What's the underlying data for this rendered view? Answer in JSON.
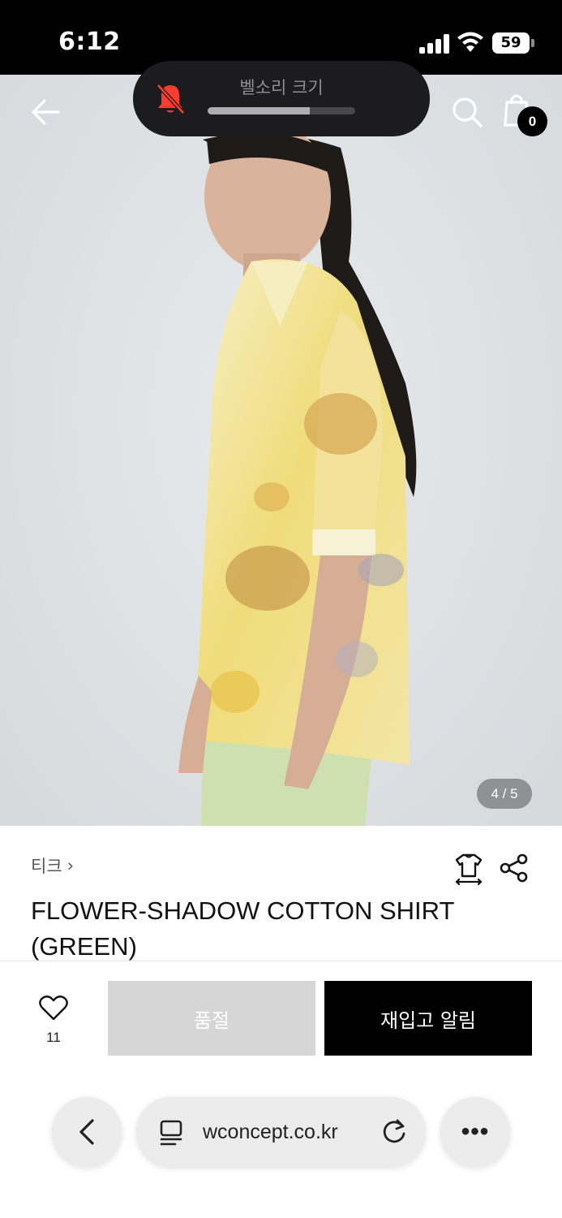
{
  "status_bar": {
    "time": "6:12",
    "battery": "59"
  },
  "header": {
    "cart_count": "0"
  },
  "volume_hud": {
    "label": "벨소리 크기",
    "level": 0.69
  },
  "gallery": {
    "counter": "4 / 5"
  },
  "product": {
    "brand": "티크",
    "brand_chevron": "›",
    "title_line1": "FLOWER-SHADOW COTTON SHIRT",
    "title_line2": "(GREEN)"
  },
  "actions": {
    "like_count": "11",
    "soldout_label": "품절",
    "restock_label": "재입고 알림"
  },
  "browser": {
    "url": "wconcept.co.kr",
    "more_label": "•••"
  },
  "icons": [
    "back-arrow-icon",
    "search-icon",
    "cart-icon",
    "bell-muted-icon",
    "size-guide-icon",
    "share-icon",
    "heart-icon",
    "chevron-left-icon",
    "page-menu-icon",
    "reload-icon",
    "more-icon"
  ]
}
